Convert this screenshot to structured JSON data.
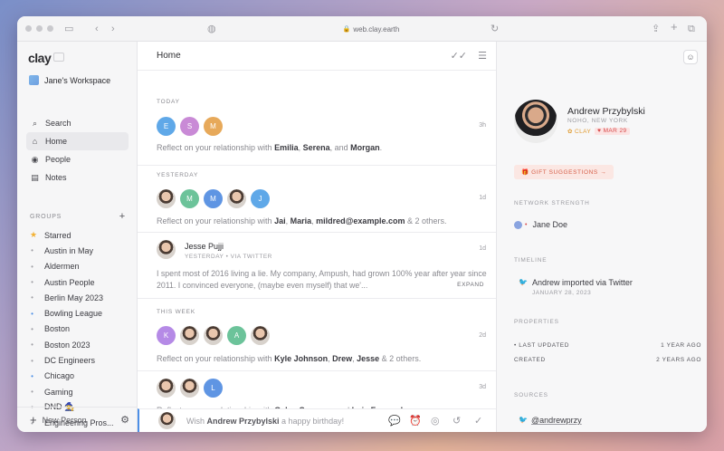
{
  "browser": {
    "url": "web.clay.earth"
  },
  "sidebar": {
    "logo": "clay",
    "workspace": "Jane's Workspace",
    "nav": [
      {
        "label": "Search",
        "icon": "search-icon"
      },
      {
        "label": "Home",
        "icon": "home-icon",
        "active": true
      },
      {
        "label": "People",
        "icon": "people-icon"
      },
      {
        "label": "Notes",
        "icon": "notes-icon"
      }
    ],
    "groups_header": "GROUPS",
    "groups": [
      {
        "label": "Starred",
        "marker": "star"
      },
      {
        "label": "Austin in May",
        "marker": "dot"
      },
      {
        "label": "Aldermen",
        "marker": "dot"
      },
      {
        "label": "Austin People",
        "marker": "dot"
      },
      {
        "label": "Berlin May 2023",
        "marker": "dot"
      },
      {
        "label": "Bowling League",
        "marker": "blue"
      },
      {
        "label": "Boston",
        "marker": "dot"
      },
      {
        "label": "Boston 2023",
        "marker": "dot"
      },
      {
        "label": "DC Engineers",
        "marker": "dot"
      },
      {
        "label": "Chicago",
        "marker": "blue"
      },
      {
        "label": "Gaming",
        "marker": "dot"
      },
      {
        "label": "DND 🧙",
        "marker": "dot"
      },
      {
        "label": "Engineering Pros...",
        "marker": "dot"
      }
    ],
    "new_person": "New Person"
  },
  "main": {
    "title": "Home",
    "sections": {
      "today": "TODAY",
      "yesterday": "YESTERDAY",
      "this_week": "THIS WEEK"
    },
    "today_row": {
      "avatars": [
        {
          "letter": "E",
          "color": "#5fa8e8"
        },
        {
          "letter": "S",
          "color": "#c98ad6"
        },
        {
          "letter": "M",
          "color": "#e7a95a"
        }
      ],
      "time": "3h",
      "prefix": "Reflect on your relationship with ",
      "n1": "Emilia",
      "sep1": ", ",
      "n2": "Serena",
      "sep2": ", and ",
      "n3": "Morgan",
      "suffix": "."
    },
    "yesterday_row": {
      "avatars": [
        {
          "letter": "",
          "color": "#d8d2cc",
          "photo": true
        },
        {
          "letter": "M",
          "color": "#6cc39a"
        },
        {
          "letter": "M",
          "color": "#5f95e3"
        },
        {
          "letter": "",
          "color": "#d8d2cc",
          "photo": true
        },
        {
          "letter": "J",
          "color": "#5fa8e8"
        }
      ],
      "time": "1d",
      "prefix": "Reflect on your relationship with ",
      "n1": "Jai",
      "sep1": ", ",
      "n2": "Maria",
      "sep2": ", ",
      "n3": "mildred@example.com",
      "suffix": " & 2 others."
    },
    "tweet": {
      "name": "Jesse Pujji",
      "meta": "YESTERDAY • VIA TWITTER",
      "time": "1d",
      "body": "I spent most of 2016 living a lie.  My company, Ampush, had grown 100% year after year since 2011. I convinced everyone, (maybe even myself) that we'...",
      "expand": "EXPAND"
    },
    "week_row1": {
      "avatars": [
        {
          "letter": "K",
          "color": "#b58ae6"
        },
        {
          "letter": "",
          "color": "#d8d2cc",
          "photo": true
        },
        {
          "letter": "",
          "color": "#d8d2cc",
          "photo": true
        },
        {
          "letter": "A",
          "color": "#6cc39a"
        },
        {
          "letter": "",
          "color": "#d8d2cc",
          "photo": true
        }
      ],
      "time": "2d",
      "prefix": "Reflect on your relationship with ",
      "n1": "Kyle Johnson",
      "sep1": ", ",
      "n2": "Drew",
      "sep2": ", ",
      "n3": "Jesse",
      "suffix": " & 2 others."
    },
    "week_row2": {
      "avatars": [
        {
          "letter": "",
          "color": "#d8d2cc",
          "photo": true
        },
        {
          "letter": "",
          "color": "#d8d2cc",
          "photo": true
        },
        {
          "letter": "L",
          "color": "#5f95e3"
        }
      ],
      "time": "3d",
      "prefix": "Reflect on your relationship with ",
      "n1": "Gaby",
      "sep1": ", ",
      "n2": "Spencer",
      "sep2": ", and ",
      "n3": "Luis Fernando",
      "suffix": "."
    },
    "compose": {
      "prefix": "Wish ",
      "name": "Andrew Przybylski",
      "suffix": " a happy birthday!"
    }
  },
  "profile": {
    "name": "Andrew Przybylski",
    "location": "NOHO, NEW YORK",
    "tag_clay": "✿ CLAY",
    "tag_date": "♥ MAR 29",
    "gift": "🎁 GIFT SUGGESTIONS →",
    "network_label": "NETWORK STRENGTH",
    "network_person": "Jane Doe",
    "timeline_label": "TIMELINE",
    "timeline_event": "Andrew imported via Twitter",
    "timeline_date": "JANUARY 28, 2023",
    "properties_label": "PROPERTIES",
    "last_updated_label": "LAST UPDATED",
    "last_updated_value": "1 YEAR AGO",
    "created_label": "CREATED",
    "created_value": "2 YEARS AGO",
    "sources_label": "SOURCES",
    "twitter_handle": "@andrewprzy"
  }
}
